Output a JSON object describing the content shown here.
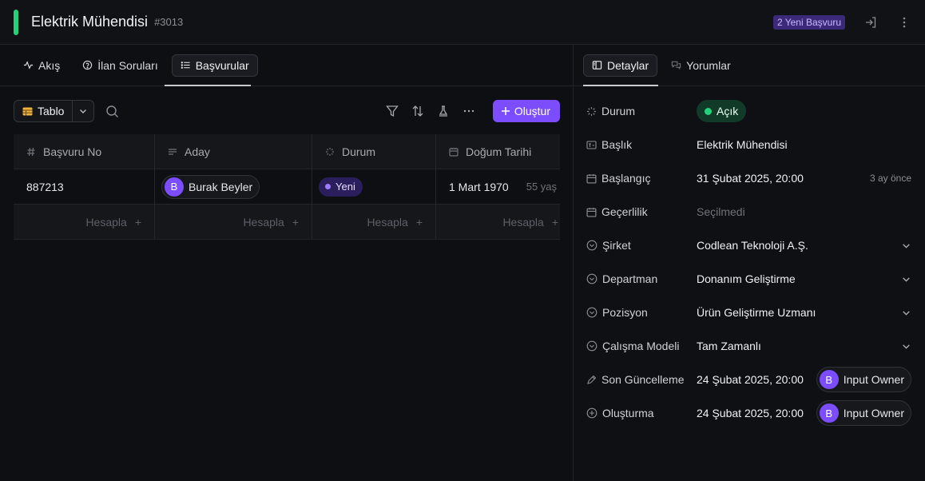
{
  "header": {
    "title": "Elektrik Mühendisi",
    "job_id": "#3013",
    "new_applications": "2 Yeni Başvuru"
  },
  "tabs": [
    {
      "label": "Akış",
      "icon": "activity-icon"
    },
    {
      "label": "İlan Soruları",
      "icon": "help-circle-icon"
    },
    {
      "label": "Başvurular",
      "icon": "list-icon",
      "active": true
    }
  ],
  "toolbar": {
    "view_label": "Tablo",
    "create_label": "Oluştur"
  },
  "table": {
    "columns": [
      "Başvuru No",
      "Aday",
      "Durum",
      "Doğum Tarihi"
    ],
    "rows": [
      {
        "no": "887213",
        "candidate": "Burak Beyler",
        "candidate_initial": "B",
        "status": "Yeni",
        "birth_date": "1 Mart 1970",
        "age": "55 yaş"
      }
    ],
    "calc_label": "Hesapla"
  },
  "right_tabs": [
    {
      "label": "Detaylar",
      "icon": "panel-icon",
      "active": true
    },
    {
      "label": "Yorumlar",
      "icon": "comments-icon"
    }
  ],
  "details": {
    "status": {
      "label": "Durum",
      "value": "Açık"
    },
    "title": {
      "label": "Başlık",
      "value": "Elektrik Mühendisi"
    },
    "start": {
      "label": "Başlangıç",
      "value": "31 Şubat 2025, 20:00",
      "relative": "3 ay önce"
    },
    "validity": {
      "label": "Geçerlilik",
      "value": "Seçilmedi"
    },
    "company": {
      "label": "Şirket",
      "value": "Codlean Teknoloji A.Ş."
    },
    "department": {
      "label": "Departman",
      "value": "Donanım Geliştirme"
    },
    "position": {
      "label": "Pozisyon",
      "value": "Ürün Geliştirme Uzmanı"
    },
    "work_model": {
      "label": "Çalışma Modeli",
      "value": "Tam Zamanlı"
    },
    "last_update": {
      "label": "Son Güncelleme",
      "value": "24 Şubat 2025, 20:00",
      "user": "Input Owner",
      "user_initial": "B"
    },
    "created": {
      "label": "Oluşturma",
      "value": "24 Şubat 2025, 20:00",
      "user": "Input Owner",
      "user_initial": "B"
    }
  },
  "colors": {
    "accent_green": "#22d37a",
    "primary_purple": "#7c4dff",
    "background": "#0e0f12"
  }
}
